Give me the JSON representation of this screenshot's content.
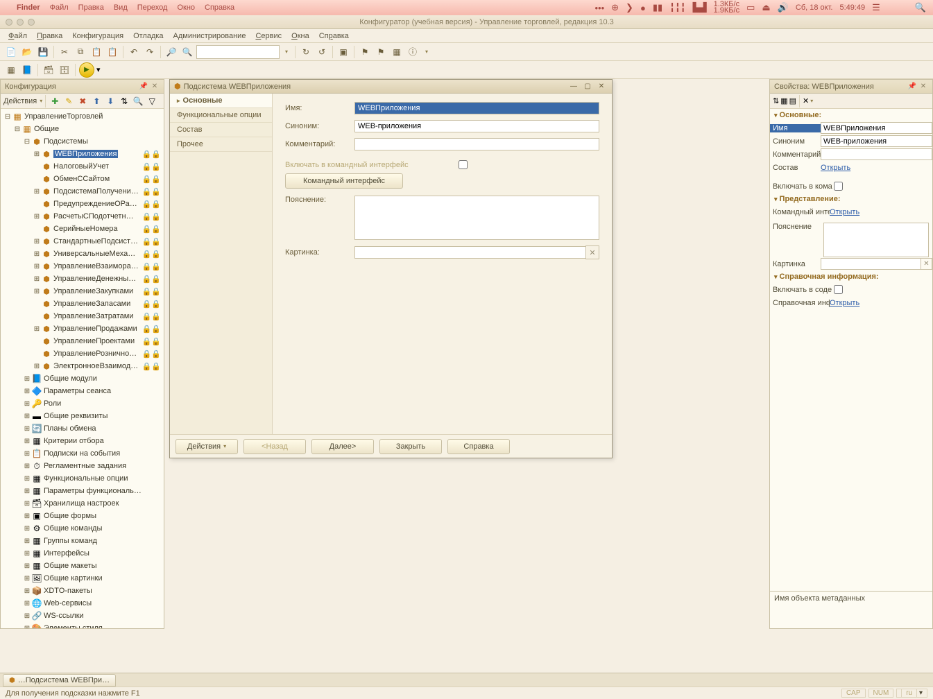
{
  "mac_menu": {
    "app": "Finder",
    "items": [
      "Файл",
      "Правка",
      "Вид",
      "Переход",
      "Окно",
      "Справка"
    ],
    "net_up": "1.3КБ/с",
    "net_down": "1.9КБ/с",
    "date": "Сб, 18 окт.",
    "time": "5:49:49"
  },
  "app": {
    "title": "Конфигуратор (учебная версия) - Управление торговлей, редакция 10.3",
    "menubar": [
      "Файл",
      "Правка",
      "Конфигурация",
      "Отладка",
      "Администрирование",
      "Сервис",
      "Окна",
      "Справка"
    ]
  },
  "config_panel": {
    "title": "Конфигурация",
    "actions_label": "Действия",
    "root": "УправлениеТорговлей",
    "common": "Общие",
    "subsystems": "Подсистемы",
    "selected": "WEBПриложения",
    "sub_items": [
      "WEBПриложения",
      "НалоговыйУчет",
      "ОбменССайтом",
      "ПодсистемаПолучени…",
      "ПредупреждениеОРа…",
      "РасчетыСПодотчетн…",
      "СерийныеНомера",
      "СтандартныеПодсист…",
      "УниверсальныеМеха…",
      "УправлениеВзаимора…",
      "УправлениеДенежны…",
      "УправлениеЗакупками",
      "УправлениеЗапасами",
      "УправлениеЗатратами",
      "УправлениеПродажами",
      "УправлениеПроектами",
      "УправлениеРознично…",
      "ЭлектронноеВзаимод…"
    ],
    "other_items": [
      "Общие модули",
      "Параметры сеанса",
      "Роли",
      "Общие реквизиты",
      "Планы обмена",
      "Критерии отбора",
      "Подписки на события",
      "Регламентные задания",
      "Функциональные опции",
      "Параметры функциональ…",
      "Хранилища настроек",
      "Общие формы",
      "Общие команды",
      "Группы команд",
      "Интерфейсы",
      "Общие макеты",
      "Общие картинки",
      "XDTO-пакеты",
      "Web-сервисы",
      "WS-ссылки",
      "Элементы стиля"
    ]
  },
  "editor": {
    "title": "Подсистема WEBПриложения",
    "nav": [
      "Основные",
      "Функциональные опции",
      "Состав",
      "Прочее"
    ],
    "labels": {
      "name": "Имя:",
      "synonym": "Синоним:",
      "comment": "Комментарий:",
      "include_cmd": "Включать в командный интерфейс",
      "cmd_interface": "Командный интерфейс",
      "explanation": "Пояснение:",
      "picture": "Картинка:"
    },
    "values": {
      "name": "WEBПриложения",
      "synonym": "WEB-приложения",
      "comment": "",
      "explanation": "",
      "picture": ""
    },
    "footer": {
      "actions": "Действия",
      "back": "<Назад",
      "next": "Далее>",
      "close": "Закрыть",
      "help": "Справка"
    }
  },
  "props": {
    "title": "Свойства: WEBПриложения",
    "sections": {
      "main": "Основные:",
      "repr": "Представление:",
      "help": "Справочная информация:"
    },
    "labels": {
      "name": "Имя",
      "synonym": "Синоним",
      "comment": "Комментарий",
      "content": "Состав",
      "open": "Открыть",
      "include_cmd": "Включать в кома",
      "cmd_iface": "Командный интер",
      "explanation": "Пояснение",
      "picture": "Картинка",
      "include_help": "Включать в соде",
      "help_info": "Справочная инф"
    },
    "values": {
      "name": "WEBПриложения",
      "synonym": "WEB-приложения",
      "comment": ""
    },
    "hint": "Имя объекта метаданных"
  },
  "taskbar": {
    "tab": "…Подсистема WEBПри…"
  },
  "statusbar": {
    "hint": "Для получения подсказки нажмите F1",
    "cap": "CAP",
    "num": "NUM",
    "lang": "ru"
  }
}
